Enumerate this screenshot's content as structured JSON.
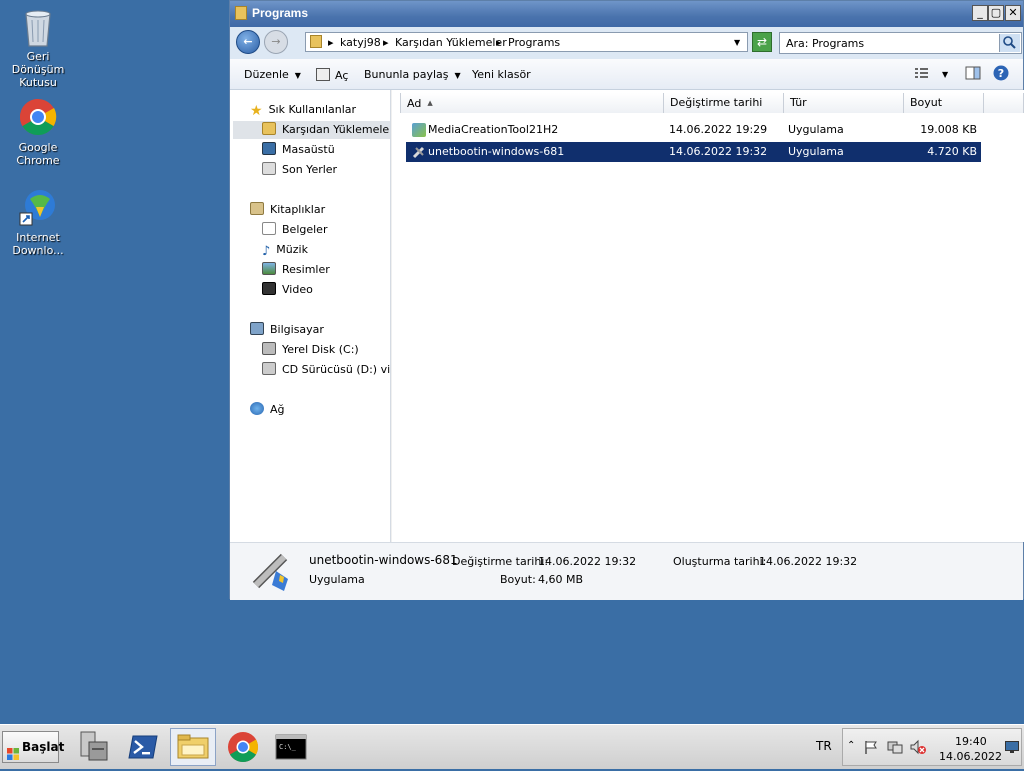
{
  "desktop": {
    "icons": [
      {
        "label": "Geri Dönüşüm Kutusu",
        "icon": "recycle-bin-icon"
      },
      {
        "label": "Google Chrome",
        "icon": "chrome-icon"
      },
      {
        "label": "Internet Downlo...",
        "icon": "internet-download-manager-icon"
      }
    ]
  },
  "window": {
    "title": "Programs",
    "address": {
      "segments": [
        "katyj98",
        "Karşıdan Yüklemeler",
        "Programs"
      ]
    },
    "search": {
      "placeholder": "Ara: Programs"
    },
    "toolbar": {
      "organize": "Düzenle",
      "open": "Aç",
      "share": "Bununla paylaş",
      "new_folder": "Yeni klasör"
    },
    "nav": {
      "favorites": "Sık Kullanılanlar",
      "fav_items": [
        "Karşıdan Yüklemeler",
        "Masaüstü",
        "Son Yerler"
      ],
      "libraries": "Kitaplıklar",
      "lib_items": [
        "Belgeler",
        "Müzik",
        "Resimler",
        "Video"
      ],
      "computer": "Bilgisayar",
      "comp_items": [
        "Yerel Disk (C:)",
        "CD Sürücüsü (D:) virtio"
      ],
      "network": "Ağ"
    },
    "columns": {
      "name": "Ad",
      "modified": "Değiştirme tarihi",
      "type": "Tür",
      "size": "Boyut"
    },
    "files": [
      {
        "name": "MediaCreationTool21H2",
        "modified": "14.06.2022 19:29",
        "type": "Uygulama",
        "size": "19.008 KB"
      },
      {
        "name": "unetbootin-windows-681",
        "modified": "14.06.2022 19:32",
        "type": "Uygulama",
        "size": "4.720 KB"
      }
    ],
    "details": {
      "name": "unetbootin-windows-681",
      "type": "Uygulama",
      "modified_label": "Değiştirme tarihi:",
      "modified": "14.06.2022 19:32",
      "size_label": "Boyut:",
      "size": "4,60 MB",
      "created_label": "Oluşturma tarihi:",
      "created": "14.06.2022 19:32"
    }
  },
  "taskbar": {
    "start_label": "Başlat",
    "lang": "TR",
    "time": "19:40",
    "date": "14.06.2022"
  },
  "colors": {
    "desktop": "#3a6ea5",
    "selection": "#102f6d",
    "titlebar": "#4a73ad"
  }
}
